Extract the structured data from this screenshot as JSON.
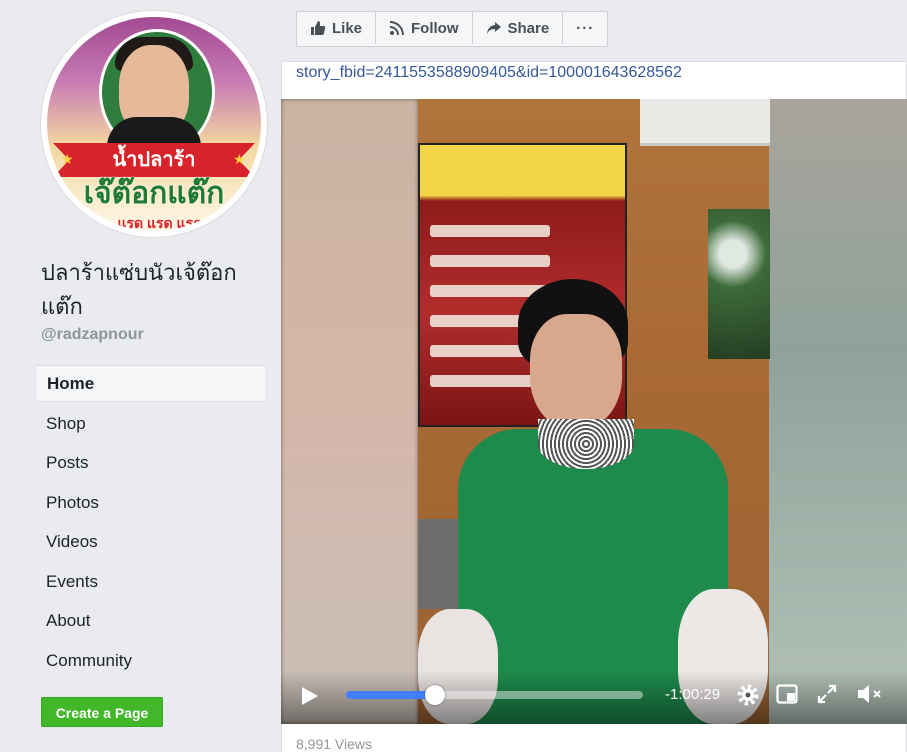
{
  "sidebar": {
    "profile_badge_text": "น้ำปลาร้า",
    "profile_brand_text": "เจ๊ต๊อกแต๊ก",
    "profile_brand_sub": "...แรด แรด แรด",
    "page_name": "ปลาร้าแซ่บนัวเจ้ต๊อกแต๊ก",
    "username": "@radzapnour",
    "nav": [
      {
        "label": "Home",
        "active": true
      },
      {
        "label": "Shop"
      },
      {
        "label": "Posts"
      },
      {
        "label": "Photos"
      },
      {
        "label": "Videos"
      },
      {
        "label": "Events"
      },
      {
        "label": "About"
      },
      {
        "label": "Community"
      }
    ],
    "create_page_label": "Create a Page"
  },
  "actions": {
    "like": "Like",
    "follow": "Follow",
    "share": "Share",
    "more": "···"
  },
  "post": {
    "url_text": "story_fbid=2411553588909405&id=100001643628562",
    "views": "8,991 Views"
  },
  "video": {
    "time_remaining": "-1:00:29",
    "progress": 0.3,
    "muted": true
  },
  "colors": {
    "link": "#365899",
    "progress": "#4080ff",
    "create_button": "#42b72a",
    "sidebar_bg": "#e9ebee"
  }
}
